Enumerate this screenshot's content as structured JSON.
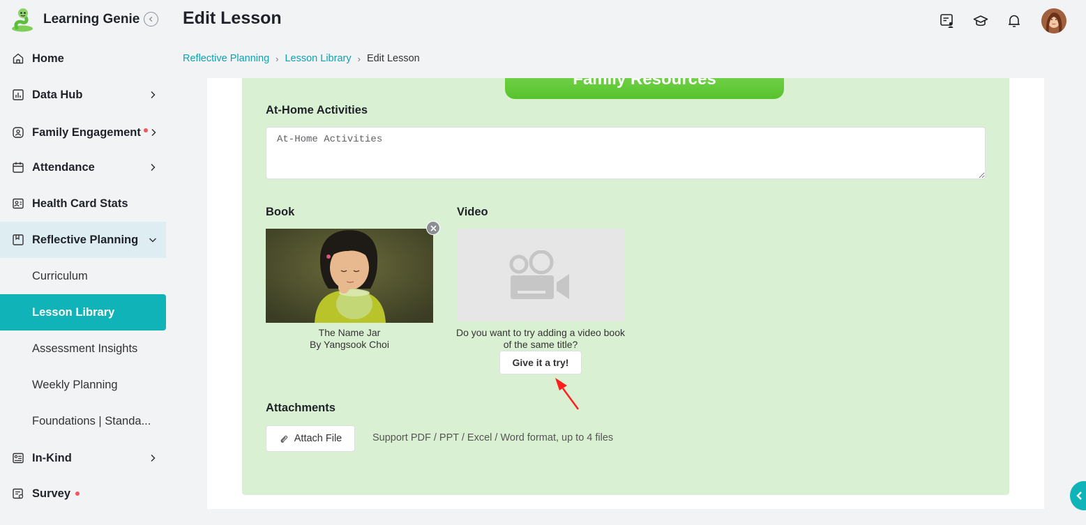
{
  "app": {
    "name": "Learning Genie"
  },
  "header": {
    "title": "Edit Lesson"
  },
  "breadcrumb": {
    "items": [
      "Reflective Planning",
      "Lesson Library"
    ],
    "current": "Edit Lesson"
  },
  "sidebar": {
    "home": "Home",
    "data_hub": "Data Hub",
    "family_engagement": "Family Engagement",
    "attendance": "Attendance",
    "health_card_stats": "Health Card Stats",
    "reflective_planning": "Reflective Planning",
    "sub_items": [
      "Curriculum",
      "Lesson Library",
      "Assessment Insights",
      "Weekly Planning",
      "Foundations | Standa..."
    ],
    "in_kind": "In-Kind",
    "survey": "Survey"
  },
  "form": {
    "section_banner": "Family Resources",
    "at_home_label": "At-Home Activities",
    "at_home_placeholder": "At-Home Activities",
    "book_label": "Book",
    "book_title": "The Name Jar",
    "book_author": "By Yangsook Choi",
    "video_label": "Video",
    "video_prompt": "Do you want to try adding a video book of the same title?",
    "try_button": "Give it a try!",
    "attachments_label": "Attachments",
    "attach_button": "Attach File",
    "attach_hint": "Support PDF / PPT / Excel / Word format, up to 4 files"
  },
  "colors": {
    "accent": "#10b3b7",
    "link": "#10a1b0",
    "panel": "#daf0d2",
    "banner": "#6bcf45",
    "notify_dot": "#f0565a"
  }
}
